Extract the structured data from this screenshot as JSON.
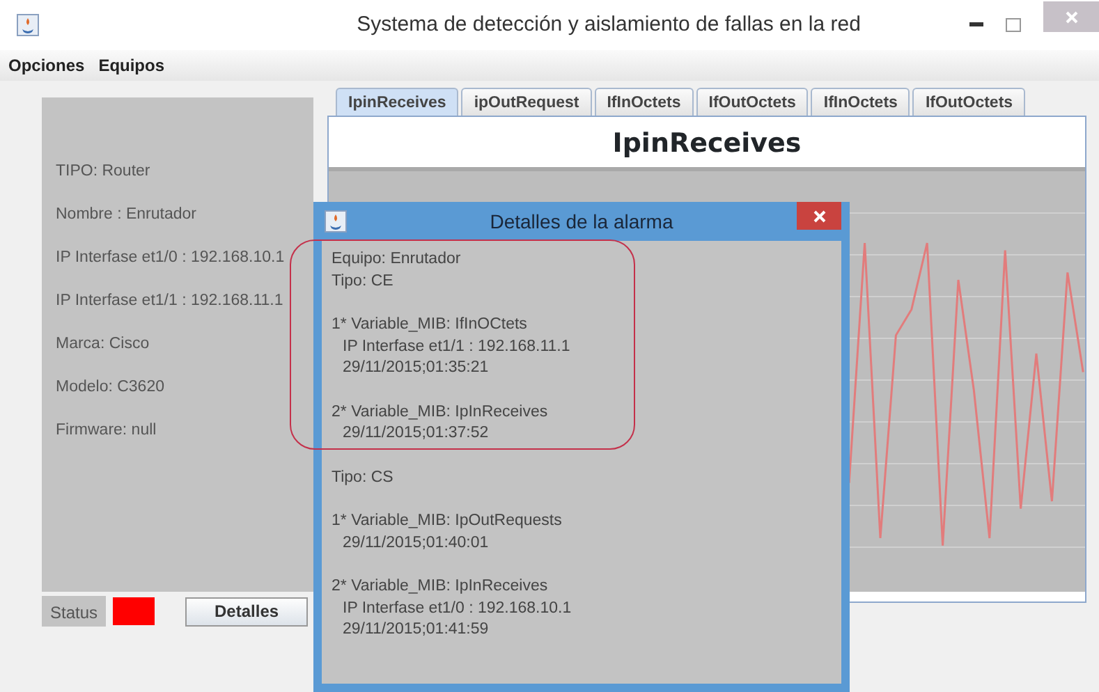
{
  "window": {
    "title": "Systema de detección y aislamiento de fallas en la red"
  },
  "menu": [
    "Opciones",
    "Equipos"
  ],
  "device_info": [
    "TIPO: Router",
    "Nombre : Enrutador",
    "IP Interfase et1/0 : 192.168.10.1",
    "IP Interfase et1/1 : 192.168.11.1",
    "Marca: Cisco",
    "Modelo: C3620",
    "Firmware: null"
  ],
  "status": {
    "label": "Status",
    "alarm": true
  },
  "details_button": "Detalles",
  "tabs": [
    {
      "label": "IpinReceives",
      "selected": true
    },
    {
      "label": "ipOutRequest",
      "selected": false
    },
    {
      "label": "IfInOctets",
      "selected": false
    },
    {
      "label": "IfOutOctets",
      "selected": false
    },
    {
      "label": "IfInOctets",
      "selected": false
    },
    {
      "label": "IfOutOctets",
      "selected": false
    }
  ],
  "chart_title": "IpinReceives",
  "dialog": {
    "title": "Detalles de la alarma",
    "sections": [
      {
        "blocks": [
          [
            {
              "text": "Equipo: Enrutador",
              "indented": false
            },
            {
              "text": "Tipo: CE",
              "indented": false
            }
          ],
          [
            {
              "text": "1* Variable_MIB: IfInOCtets",
              "indented": false
            },
            {
              "text": "IP Interfase et1/1 : 192.168.11.1",
              "indented": true
            },
            {
              "text": "29/11/2015;01:35:21",
              "indented": true
            }
          ],
          [
            {
              "text": "2* Variable_MIB: IpInReceives",
              "indented": false
            },
            {
              "text": "29/11/2015;01:37:52",
              "indented": true
            }
          ]
        ]
      },
      {
        "blocks": [
          [
            {
              "text": "Tipo: CS",
              "indented": false
            }
          ],
          [
            {
              "text": "1* Variable_MIB: IpOutRequests",
              "indented": false
            },
            {
              "text": "29/11/2015;01:40:01",
              "indented": true
            }
          ],
          [
            {
              "text": "2* Variable_MIB: IpInReceives",
              "indented": false
            },
            {
              "text": "IP Interfase et1/0 : 192.168.10.1",
              "indented": true
            },
            {
              "text": "29/11/2015;01:41:59",
              "indented": true
            }
          ]
        ]
      }
    ]
  }
}
